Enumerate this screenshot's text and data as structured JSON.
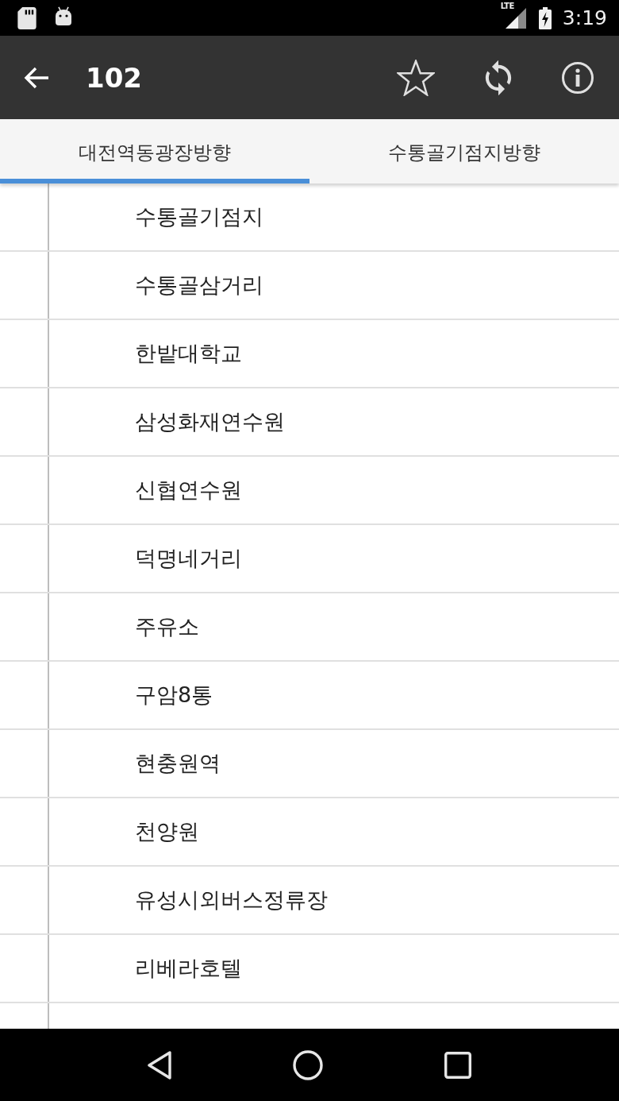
{
  "status_bar": {
    "network": "LTE",
    "time": "3:19"
  },
  "app_bar": {
    "title": "102",
    "starred": false
  },
  "tabs": [
    {
      "label": "대전역동광장방향",
      "selected": true
    },
    {
      "label": "수통골기점지방향",
      "selected": false
    }
  ],
  "stops": [
    "수통골기점지",
    "수통골삼거리",
    "한밭대학교",
    "삼성화재연수원",
    "신협연수원",
    "덕명네거리",
    "주유소",
    "구암8통",
    "현충원역",
    "천양원",
    "유성시외버스정류장",
    "리베라호텔"
  ]
}
